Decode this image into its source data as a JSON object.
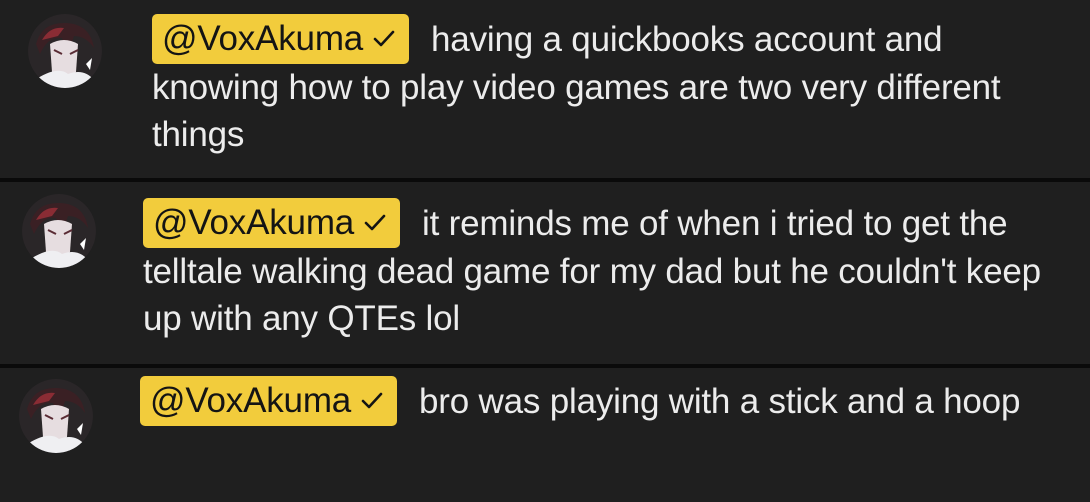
{
  "messages": [
    {
      "mention": "@VoxAkuma",
      "body": "having a quickbooks account and knowing how to play video games are two very different things"
    },
    {
      "mention": "@VoxAkuma",
      "body": "it reminds me of when i tried to get the telltale walking dead game for my dad but he couldn't keep up with any QTEs lol"
    },
    {
      "mention": "@VoxAkuma",
      "body": "bro was playing with a stick and a hoop"
    }
  ],
  "icons": {
    "avatar": "user-avatar-icon",
    "verified": "checkmark-icon"
  },
  "colors": {
    "message_background": "#1f1f1f",
    "mention_highlight": "#f2cc3c",
    "mention_text": "#141414",
    "body_text": "#ececec"
  }
}
